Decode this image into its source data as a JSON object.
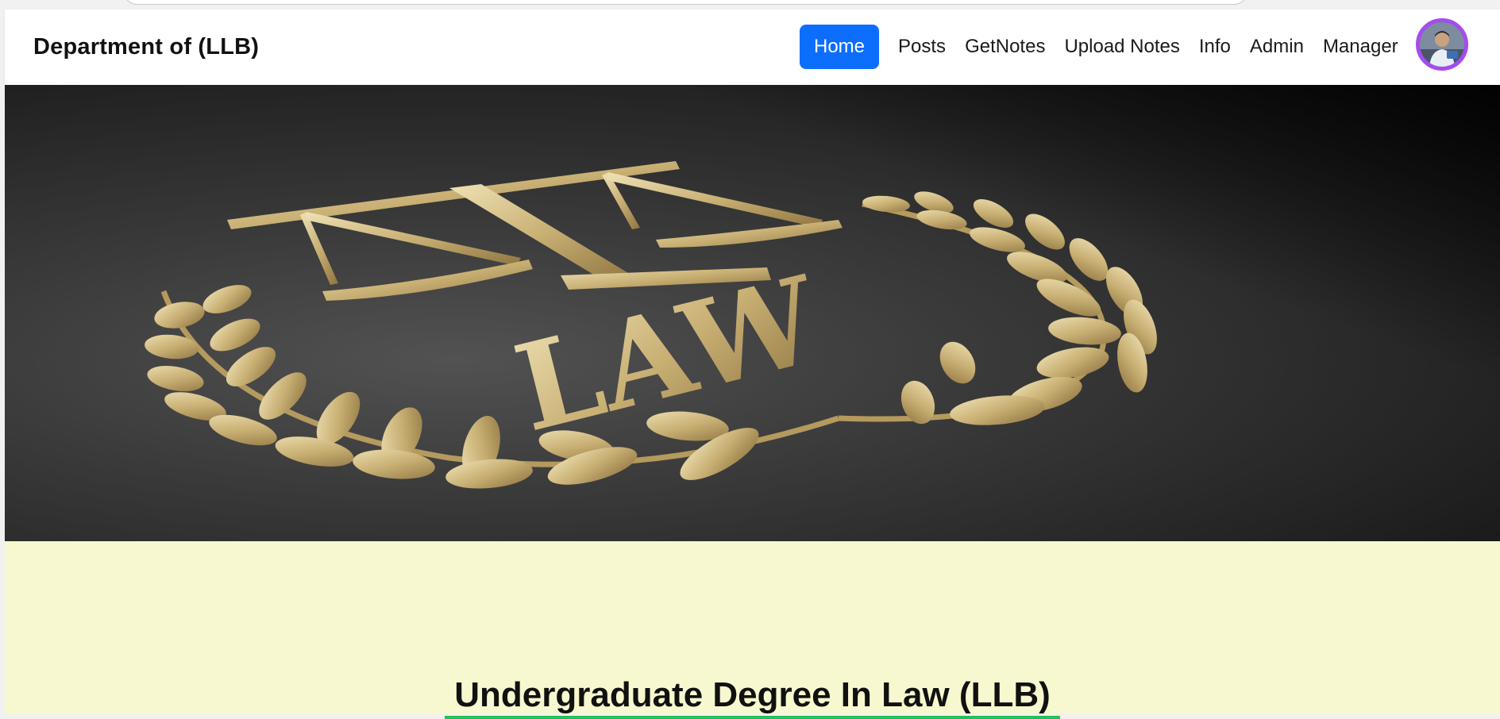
{
  "navbar": {
    "brand": "Department of (LLB)",
    "items": [
      {
        "label": "Home",
        "active": true
      },
      {
        "label": "Posts"
      },
      {
        "label": "GetNotes"
      },
      {
        "label": "Upload Notes"
      },
      {
        "label": "Info"
      },
      {
        "label": "Admin"
      },
      {
        "label": "Manager"
      }
    ],
    "accent_color": "#0d6efd",
    "avatar_ring_color": "#a44cf0"
  },
  "hero": {
    "image": "law-emblem-scales-laurel",
    "emblem_text": "LAW"
  },
  "main": {
    "heading": "Undergraduate Degree In Law (LLB)",
    "underline_color": "#22c25a",
    "background_color": "#f8f8d0"
  }
}
